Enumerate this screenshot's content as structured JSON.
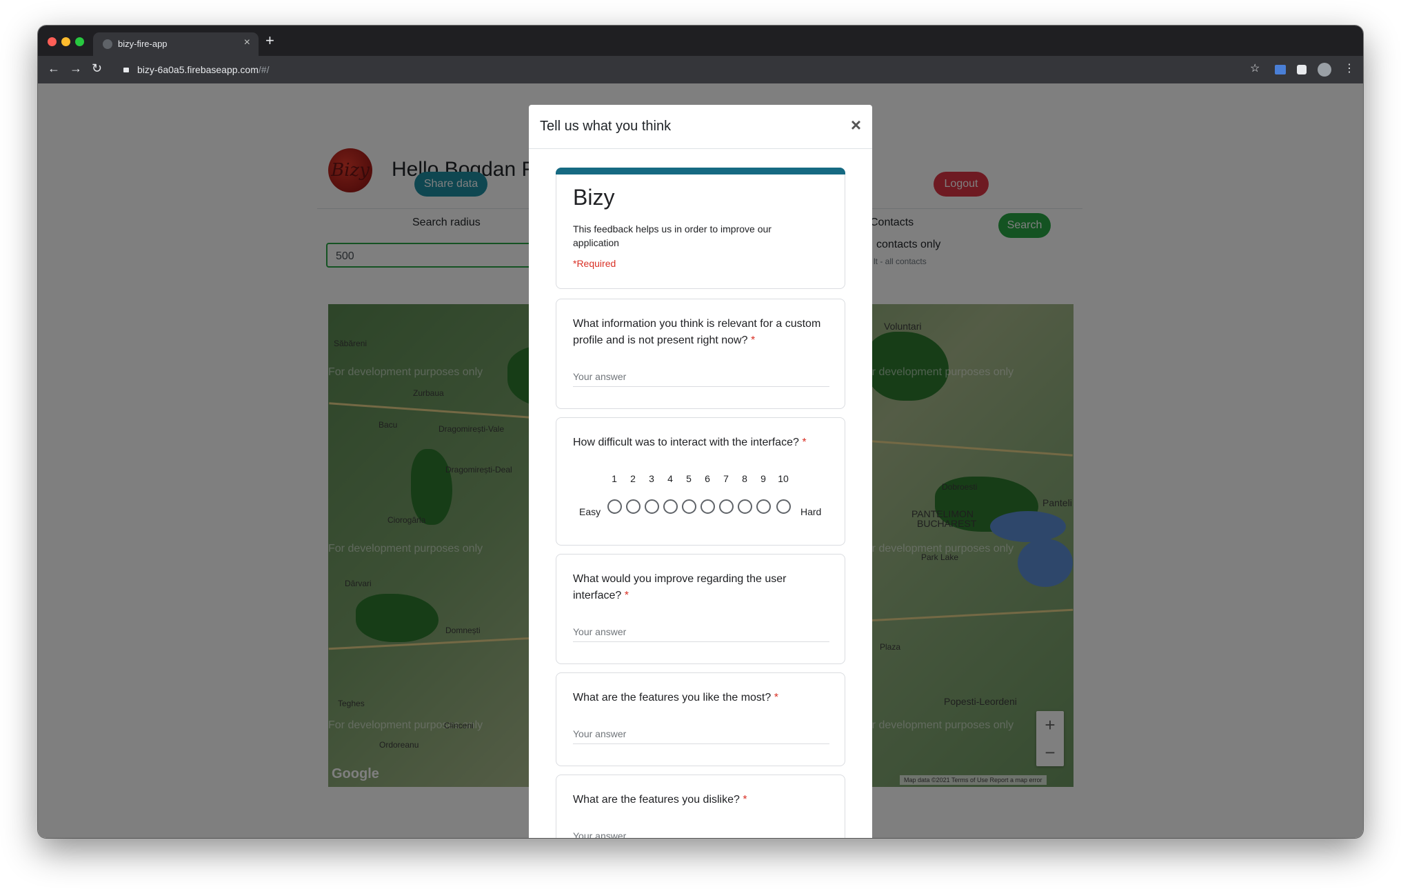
{
  "browser": {
    "tab_title": "bizy-fire-app",
    "tab_close": "×",
    "new_tab": "+",
    "url_host": "bizy-6a0a5.firebaseapp.com",
    "url_path": "/#/",
    "back": "←",
    "forward": "→",
    "reload": "↻",
    "star": "☆",
    "menu": "⋮"
  },
  "app": {
    "logo_text": "Bizy",
    "greeting": "Hello Bogdan F",
    "share_button": "Share data",
    "logout_button": "Logout",
    "search_radius_label": "Search radius",
    "search_radius_value": "500",
    "contacts_label": "Contacts",
    "contacts_only_label": "contacts only",
    "contacts_hint": "lt - all contacts",
    "search_button": "Search",
    "colors": {
      "share": "#1e8ea3",
      "logout": "#dc3545",
      "search": "#28a745"
    }
  },
  "map": {
    "watermark": "For development purposes only",
    "places": [
      "Săbăreni",
      "Zurbaua",
      "Bacu",
      "Dragomirești-Vale",
      "Dragomirești-Deal",
      "Ciorogârla",
      "Dârvari",
      "Domnești",
      "Teghes",
      "Ordoreanu",
      "Clinceni",
      "Voluntari",
      "Dobroesti",
      "PANTELIMON",
      "BUCHAREST",
      "Panteli",
      "Park Lake",
      "Popesti-Leordeni",
      "Plaza"
    ],
    "zoom_in": "+",
    "zoom_out": "−",
    "google": "Google",
    "footer": "Map data ©2021   Terms of Use   Report a map error"
  },
  "modal": {
    "title": "Tell us what you think",
    "close": "×",
    "form": {
      "title": "Bizy",
      "description": "This feedback helps us in order to improve our application",
      "required_note": "*Required",
      "accent": "#166a82"
    },
    "questions": [
      {
        "text": "What information you think is relevant for a custom profile and is not present right now?",
        "placeholder": "Your answer"
      },
      {
        "text": "How difficult was to interact with the interface?",
        "scale": [
          "1",
          "2",
          "3",
          "4",
          "5",
          "6",
          "7",
          "8",
          "9",
          "10"
        ],
        "low": "Easy",
        "high": "Hard"
      },
      {
        "text": "What would you improve regarding the user interface?",
        "placeholder": "Your answer"
      },
      {
        "text": "What are the features you like the most?",
        "placeholder": "Your answer"
      },
      {
        "text": "What are the features you dislike?",
        "placeholder": "Your answer"
      }
    ],
    "required_star": "*"
  }
}
